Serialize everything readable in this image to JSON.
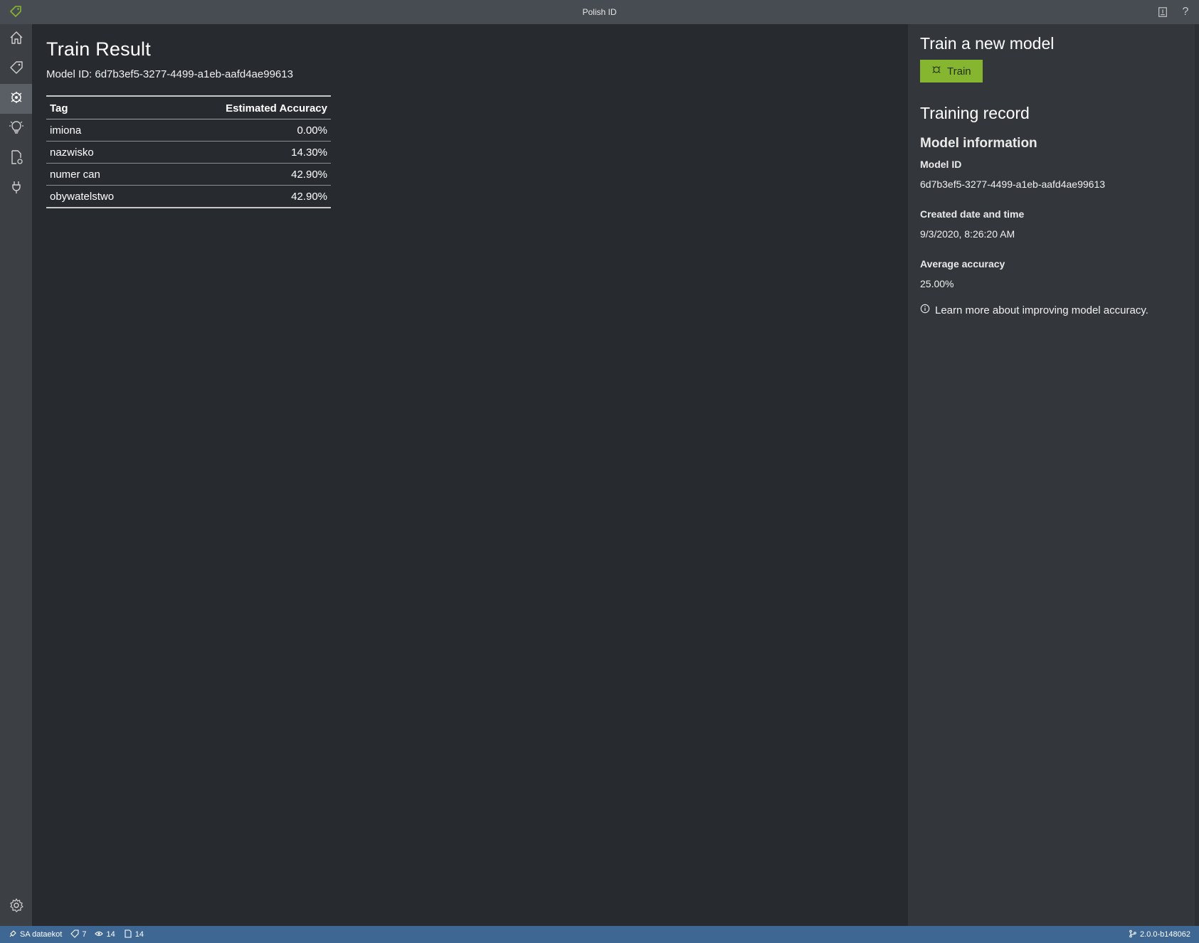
{
  "window": {
    "title": "Polish ID",
    "logo_icon": "tag-icon",
    "right_icons": [
      "keyboard-shortcuts-icon",
      "help-icon"
    ],
    "help_glyph": "?"
  },
  "leftnav": {
    "items": [
      {
        "name": "home",
        "icon": "home-icon"
      },
      {
        "name": "tag-editor",
        "icon": "tag-icon"
      },
      {
        "name": "train",
        "icon": "train-icon",
        "active": true
      },
      {
        "name": "predict",
        "icon": "lightbulb-icon"
      },
      {
        "name": "analyze",
        "icon": "document-gear-icon"
      },
      {
        "name": "connections",
        "icon": "plug-icon"
      }
    ],
    "settings_icon": "gear-icon"
  },
  "main": {
    "title": "Train Result",
    "model_id_text": "Model ID: 6d7b3ef5-3277-4499-a1eb-aafd4ae99613",
    "table": {
      "headers": [
        "Tag",
        "Estimated Accuracy"
      ],
      "rows": [
        {
          "tag": "imiona",
          "accuracy": "0.00%"
        },
        {
          "tag": "nazwisko",
          "accuracy": "14.30%"
        },
        {
          "tag": "numer can",
          "accuracy": "42.90%"
        },
        {
          "tag": "obywatelstwo",
          "accuracy": "42.90%"
        }
      ]
    }
  },
  "rightpane": {
    "train_heading": "Train a new model",
    "train_button": "Train",
    "record_heading": "Training record",
    "model_info_heading": "Model information",
    "model_id_label": "Model ID",
    "model_id_value": "6d7b3ef5-3277-4499-a1eb-aafd4ae99613",
    "created_label": "Created date and time",
    "created_value": "9/3/2020, 8:26:20 AM",
    "avg_label": "Average accuracy",
    "avg_value": "25.00%",
    "learn_more": "Learn more about improving model accuracy."
  },
  "statusbar": {
    "connection": "SA dataekot",
    "tags_count": "7",
    "visited_count": "14",
    "assets_count": "14",
    "version": "2.0.0-b148062"
  },
  "colors": {
    "accent_green": "#86b530",
    "statusbar_blue": "#3f6794",
    "titlebar": "#474c52",
    "main_bg": "#272b30",
    "right_bg": "#33373c"
  }
}
